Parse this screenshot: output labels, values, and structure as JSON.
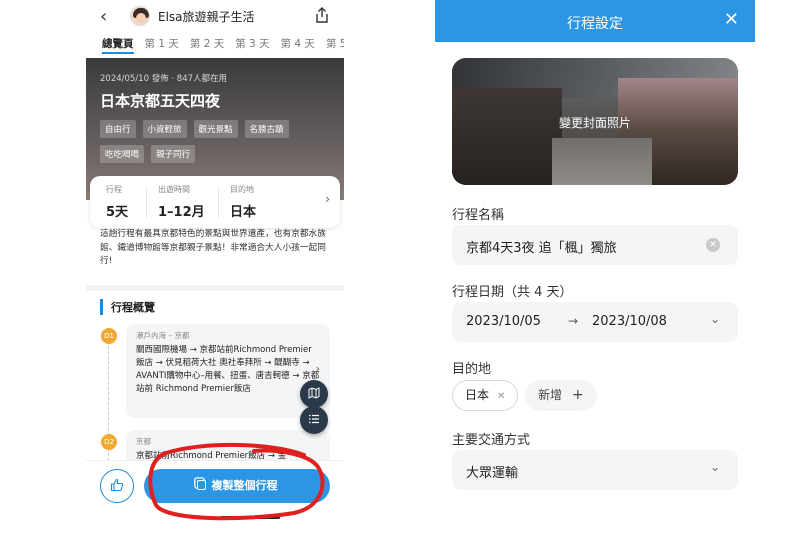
{
  "left": {
    "header": {
      "back": "‹",
      "username": "Elsa旅遊親子生活"
    },
    "tabs": [
      {
        "label": "總覽頁",
        "active": true
      },
      {
        "label": "第 1 天"
      },
      {
        "label": "第 2 天"
      },
      {
        "label": "第 3 天"
      },
      {
        "label": "第 4 天"
      },
      {
        "label": "第 5 天"
      }
    ],
    "cover": {
      "meta": "2024/05/10 發佈 · 847人都在用",
      "title": "日本京都五天四夜",
      "tags": [
        "自由行",
        "小資輕旅",
        "觀光景點",
        "名勝古蹟",
        "吃吃喝喝",
        "親子同行"
      ]
    },
    "stats": [
      {
        "label": "行程",
        "value": "5天"
      },
      {
        "label": "出遊時間",
        "value": "1–12月"
      },
      {
        "label": "目的地",
        "value": "日本"
      }
    ],
    "description": "這趟行程有最具京都特色的景點與世界遺產，也有京都水族館、鐵道博物館等京都親子景點！非常適合大人小孩一起同行!",
    "overview_title": "行程概覽",
    "days": [
      {
        "badge": "D1",
        "region": "瀨戶內海 – 京都",
        "route": "關西國際機場 → 京都站前Richmond Premier飯店 → 伏見稻荷大社 奧社奉拜所 → 醍醐寺 → AVANTI購物中心–用餐、扭蛋、唐吉軻德 → 京都站前 Richmond Premier飯店"
      },
      {
        "badge": "D2",
        "region": "京都",
        "route": "京都站前Richmond Premier飯店 → 金"
      }
    ],
    "copy_button": "複製整個行程",
    "accent": "#2a96e4",
    "annotation_color": "#e0201f"
  },
  "right": {
    "title": "行程設定",
    "close": "✕",
    "cover_label": "變更封面照片",
    "name_label": "行程名稱",
    "name_value": "京都4天3夜 追「楓」獨旅",
    "date_label": "行程日期（共 4 天）",
    "date_start": "2023/10/05",
    "date_arrow": "→",
    "date_end": "2023/10/08",
    "dest_label": "目的地",
    "dest_chip": "日本",
    "add_chip": "新增",
    "transport_label": "主要交通方式",
    "transport_value": "大眾運輸",
    "header_color": "#2a96e4"
  }
}
